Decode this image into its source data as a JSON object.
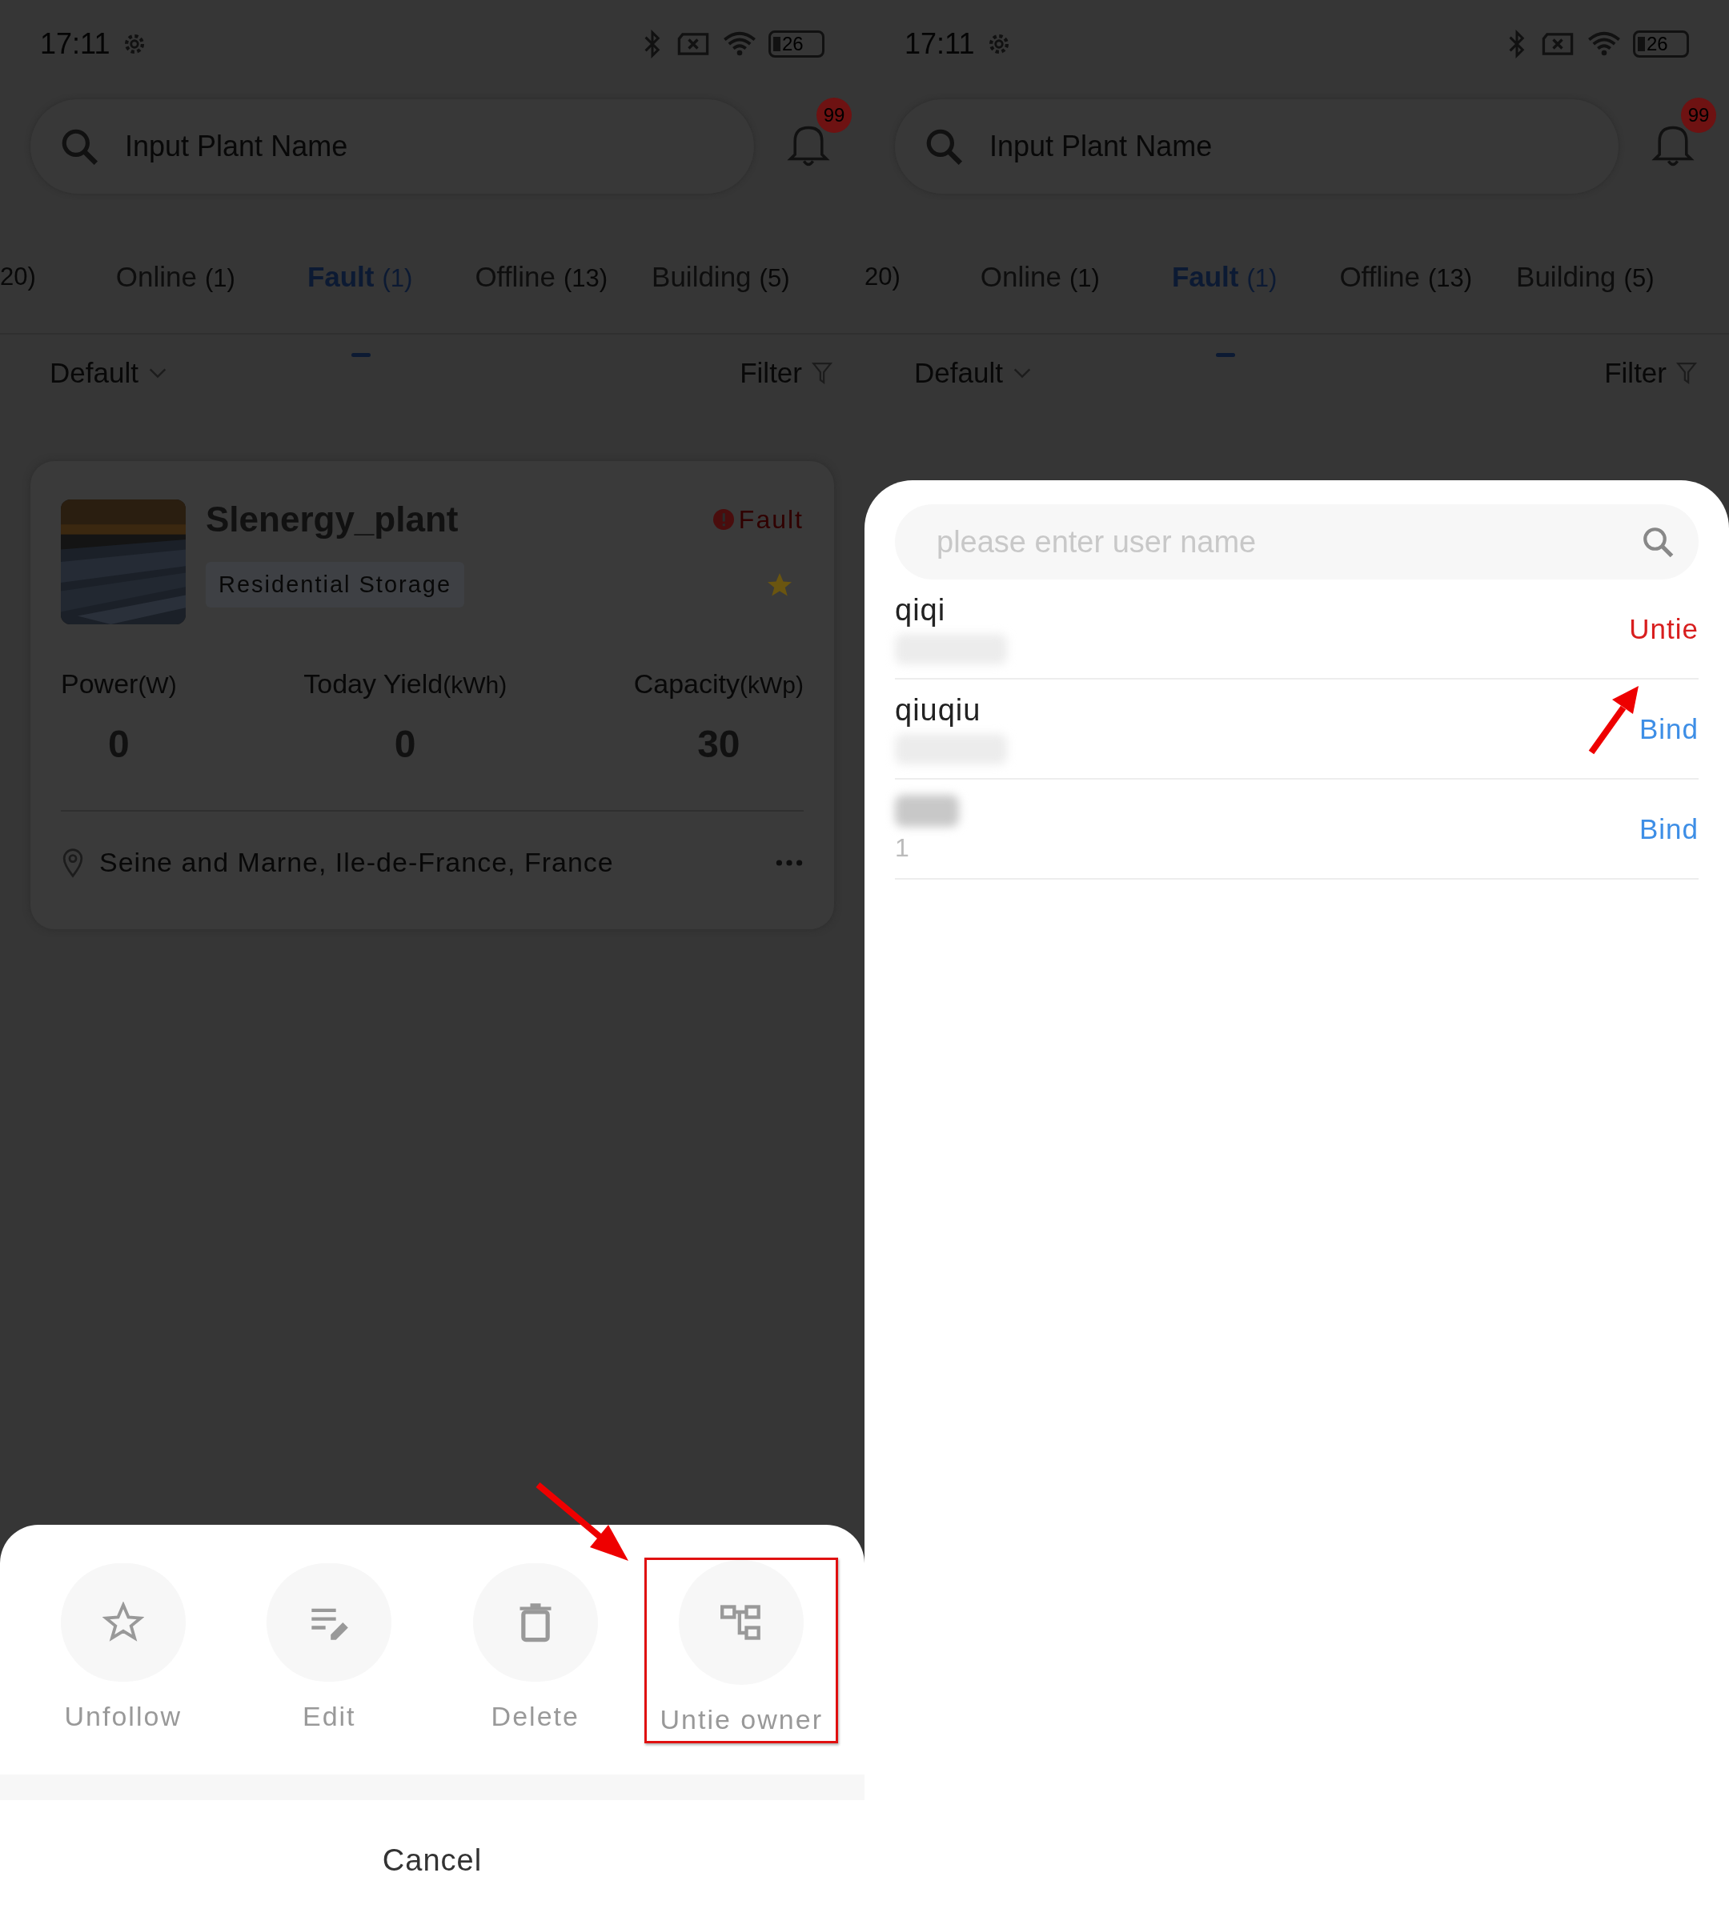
{
  "screens": [
    {
      "status": {
        "time": "17:11",
        "battery": "26"
      },
      "search": {
        "placeholder": "Input Plant Name"
      },
      "notifications": {
        "badge": "99"
      },
      "tabs": [
        {
          "count": "20)",
          "selected": false
        },
        {
          "label": "Online",
          "count": "(1)",
          "selected": false
        },
        {
          "label": "Fault",
          "count": "(1)",
          "selected": true
        },
        {
          "label": "Offline",
          "count": "(13)",
          "selected": false
        },
        {
          "label": "Building",
          "count": "(5)",
          "selected": false
        }
      ],
      "sort": {
        "label": "Default",
        "filter": "Filter"
      },
      "card": {
        "name": "Slenergy_plant",
        "status": "Fault",
        "type": "Residential Storage",
        "favorite": true,
        "stats": [
          {
            "label": "Power",
            "unit": "(W)",
            "value": "0"
          },
          {
            "label": "Today Yield",
            "unit": "(kWh)",
            "value": "0"
          },
          {
            "label": "Capacity",
            "unit": "(kWp)",
            "value": "30"
          }
        ],
        "location": "Seine and Marne, Ile-de-France, France"
      },
      "action_sheet": {
        "actions": [
          {
            "kind": "star",
            "label": "Unfollow",
            "highlighted": false
          },
          {
            "kind": "edit",
            "label": "Edit",
            "highlighted": false
          },
          {
            "kind": "delete",
            "label": "Delete",
            "highlighted": false
          },
          {
            "kind": "owner",
            "label": "Untie owner",
            "highlighted": true
          }
        ],
        "cancel": "Cancel"
      }
    },
    {
      "status": {
        "time": "17:11",
        "battery": "26"
      },
      "search": {
        "placeholder": "Input Plant Name"
      },
      "notifications": {
        "badge": "99"
      },
      "tabs": [
        {
          "count": "20)",
          "selected": false
        },
        {
          "label": "Online",
          "count": "(1)",
          "selected": false
        },
        {
          "label": "Fault",
          "count": "(1)",
          "selected": true
        },
        {
          "label": "Offline",
          "count": "(13)",
          "selected": false
        },
        {
          "label": "Building",
          "count": "(5)",
          "selected": false
        }
      ],
      "sort": {
        "label": "Default",
        "filter": "Filter"
      },
      "user_sheet": {
        "placeholder": "please enter user name",
        "users": [
          {
            "name": "qiqi",
            "name_redacted": false,
            "detail_redacted": true,
            "action": "Untie",
            "kind": "untie"
          },
          {
            "name": "qiuqiu",
            "name_redacted": false,
            "detail_redacted": true,
            "action": "Bind",
            "kind": "bind"
          },
          {
            "name_redacted": true,
            "detail": "1",
            "detail_redacted": false,
            "action": "Bind",
            "kind": "bind"
          }
        ]
      }
    }
  ]
}
